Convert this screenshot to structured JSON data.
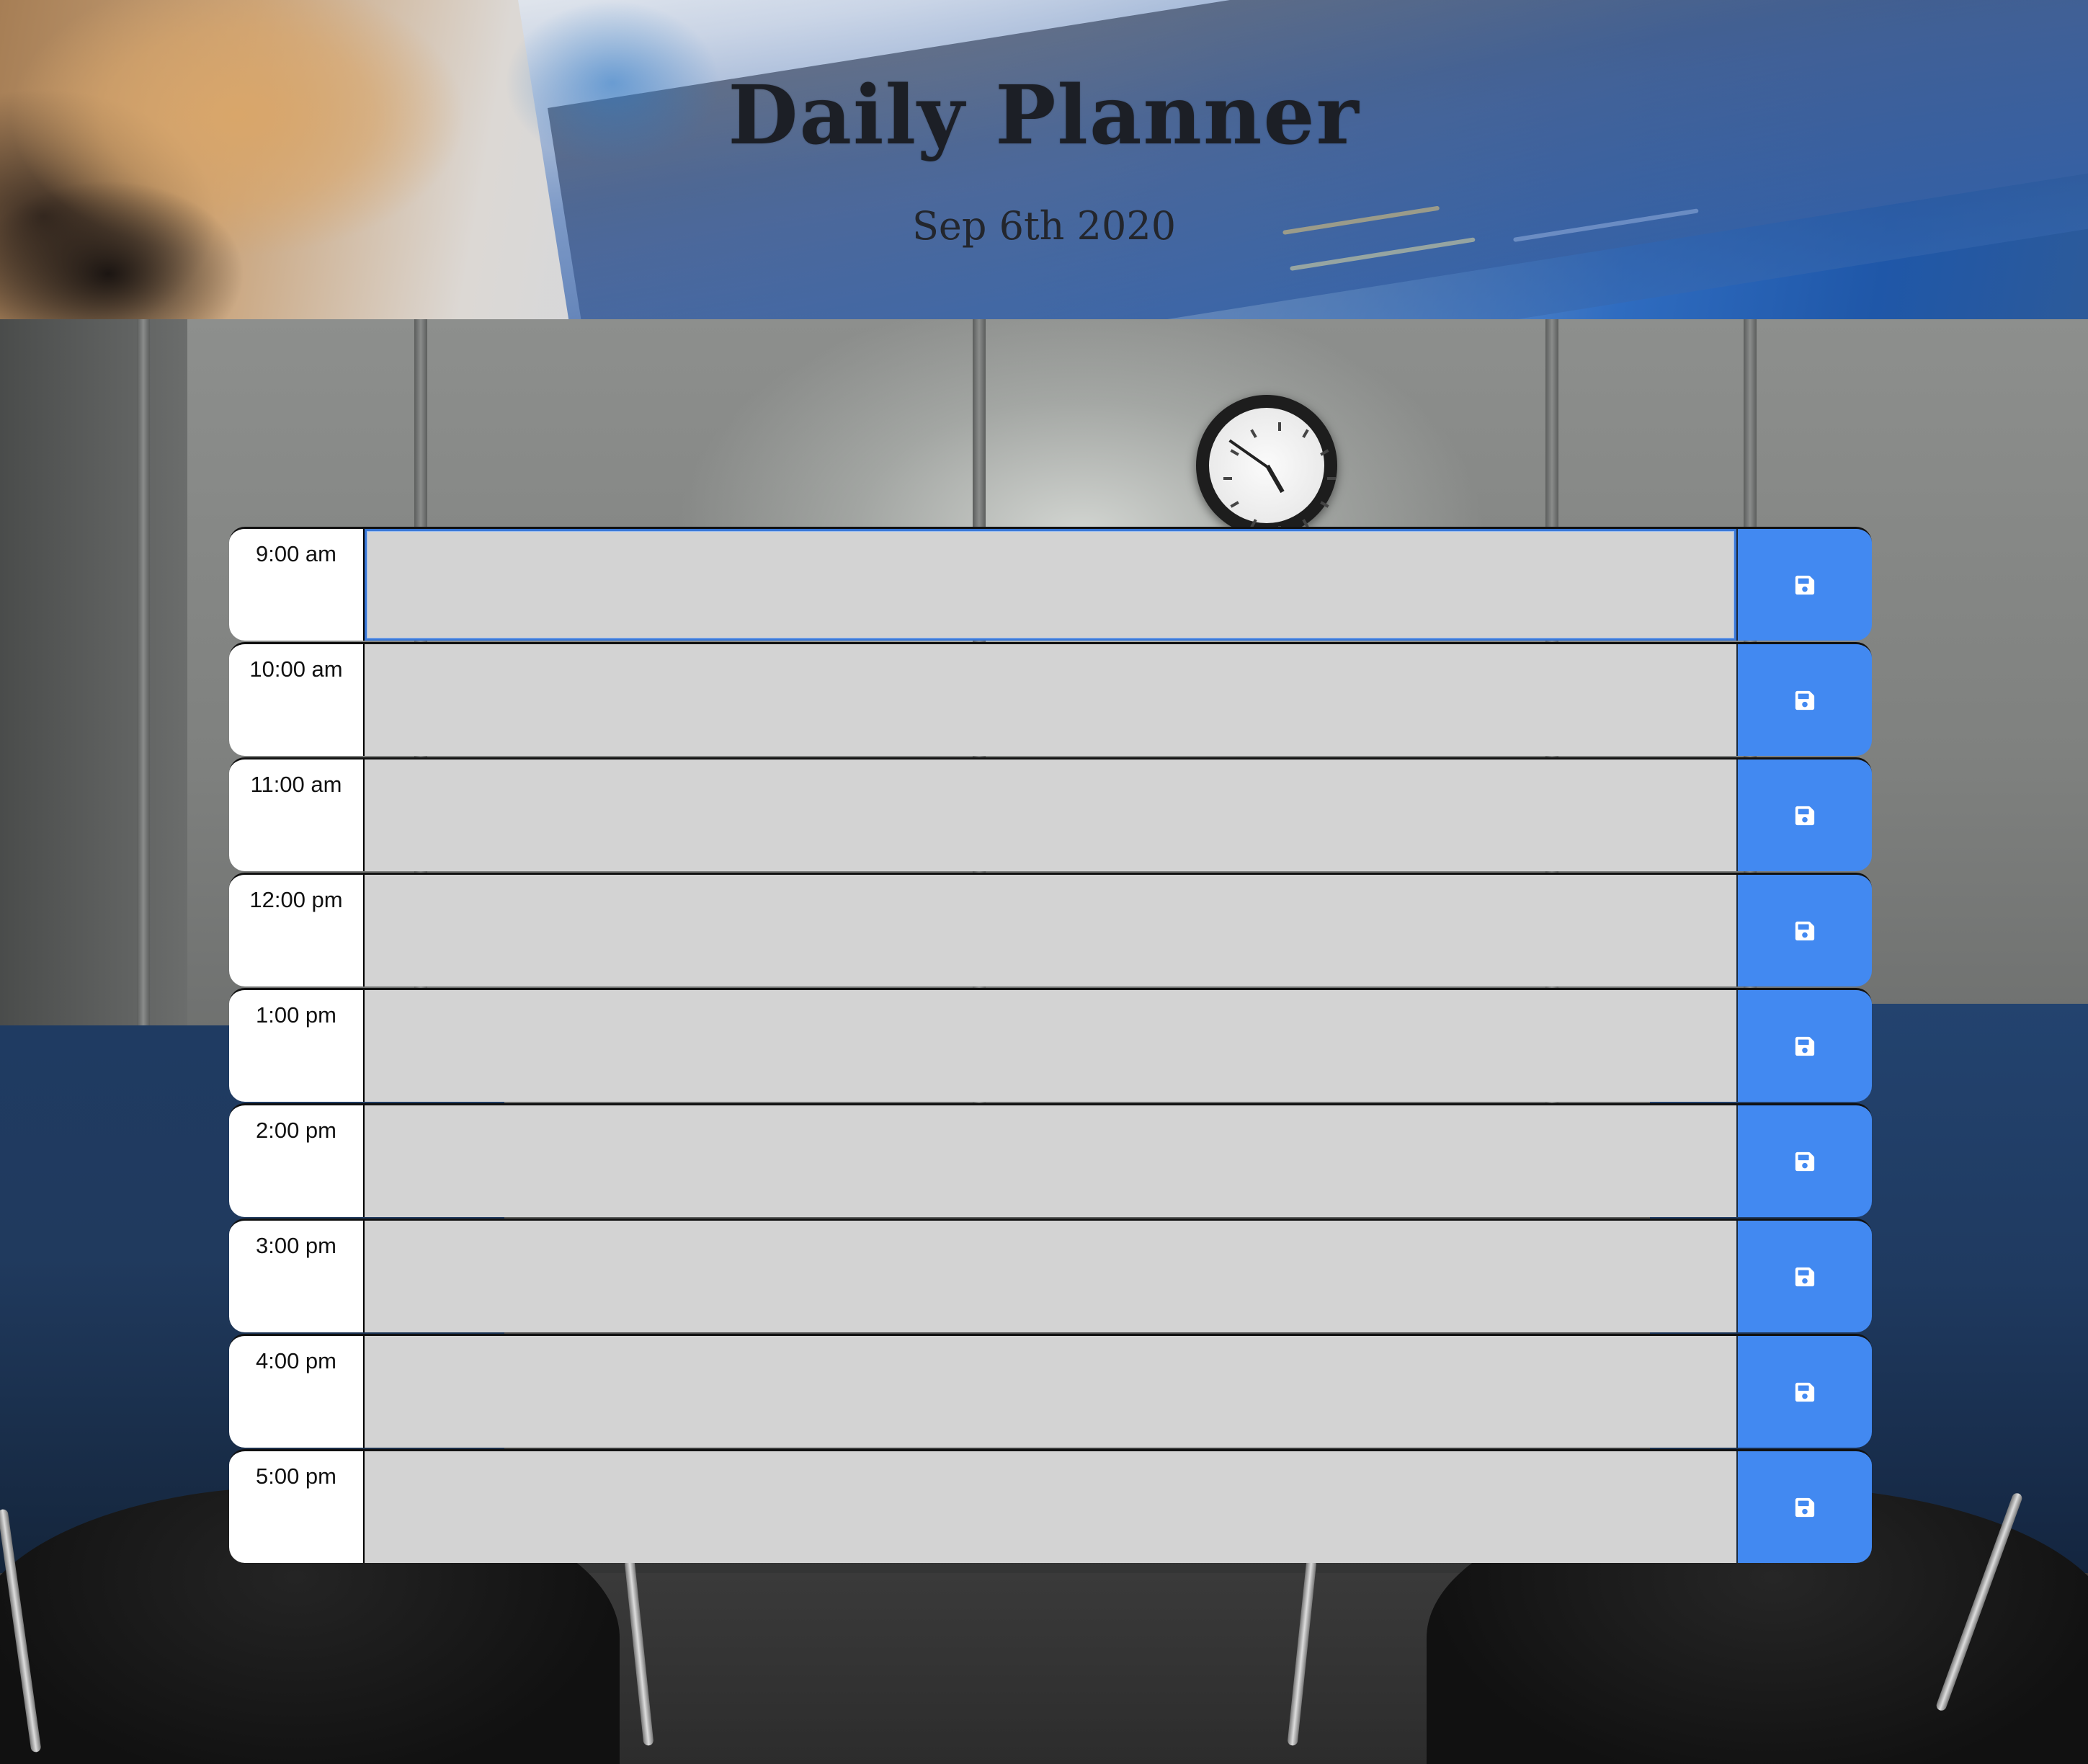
{
  "header": {
    "title": "Daily Planner",
    "date": "Sep 6th 2020"
  },
  "planner": {
    "rows": [
      {
        "hour": "9:00 am",
        "text": "",
        "focused": true
      },
      {
        "hour": "10:00 am",
        "text": ""
      },
      {
        "hour": "11:00 am",
        "text": ""
      },
      {
        "hour": "12:00 pm",
        "text": ""
      },
      {
        "hour": "1:00 pm",
        "text": ""
      },
      {
        "hour": "2:00 pm",
        "text": ""
      },
      {
        "hour": "3:00 pm",
        "text": ""
      },
      {
        "hour": "4:00 pm",
        "text": ""
      },
      {
        "hour": "5:00 pm",
        "text": ""
      }
    ],
    "save_icon": "save-icon"
  },
  "colors": {
    "save_button": "#4289f1",
    "textarea_bg": "#d3d3d3",
    "hour_bg": "#ffffff",
    "focus_border": "#3a78d8"
  }
}
